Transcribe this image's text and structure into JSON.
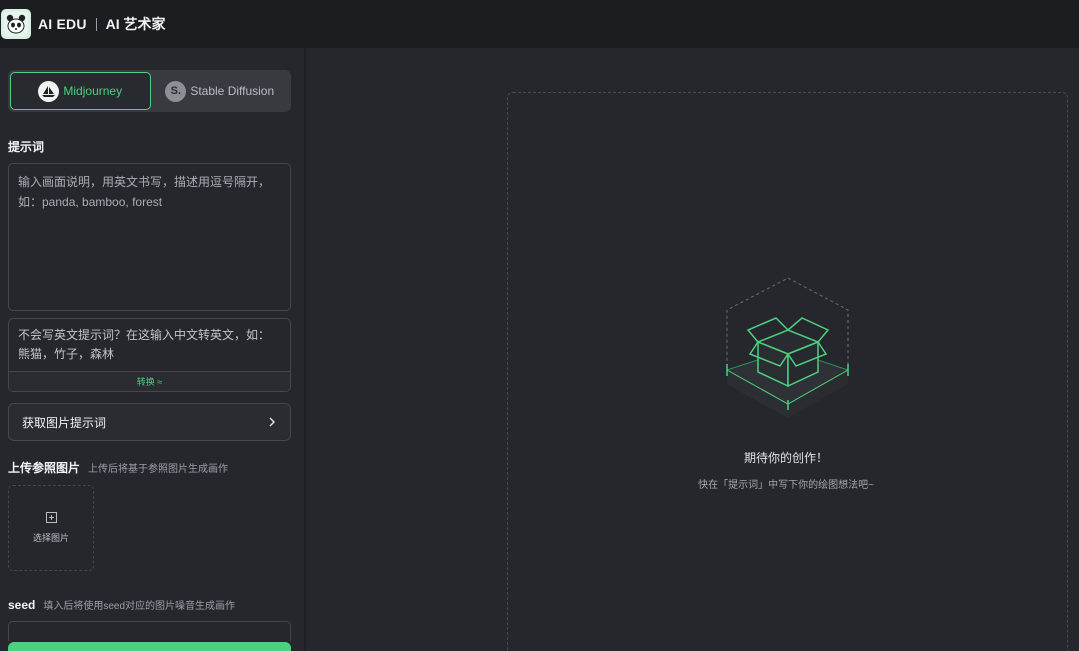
{
  "header": {
    "brand": "AI EDU",
    "subtitle": "AI 艺术家"
  },
  "engines": {
    "items": [
      {
        "label": "Midjourney",
        "icon": "sailboat-icon",
        "active": true
      },
      {
        "label": "Stable Diffusion",
        "icon": "s-letter-icon",
        "active": false
      }
    ]
  },
  "prompt": {
    "label": "提示词",
    "placeholder": "输入画面说明，用英文书写，描述用逗号隔开，如：panda, bamboo, forest"
  },
  "translate": {
    "placeholder": "不会写英文提示词？在这输入中文转英文，如：熊猫，竹子，森林",
    "button": "转换 ≈"
  },
  "fetch_prompt": {
    "label": "获取图片提示词"
  },
  "reference": {
    "label": "上传参照图片",
    "hint": "上传后将基于参照图片生成画作",
    "upload_label": "选择图片"
  },
  "seed": {
    "label": "seed",
    "hint": "填入后将使用seed对应的图片噪音生成画作"
  },
  "empty_state": {
    "title": "期待你的创作！",
    "subtitle": "快在「提示词」中写下你的绘图想法吧~"
  },
  "colors": {
    "accent": "#4dd07f",
    "background": "#25272c",
    "topbar": "#1c1d20"
  }
}
